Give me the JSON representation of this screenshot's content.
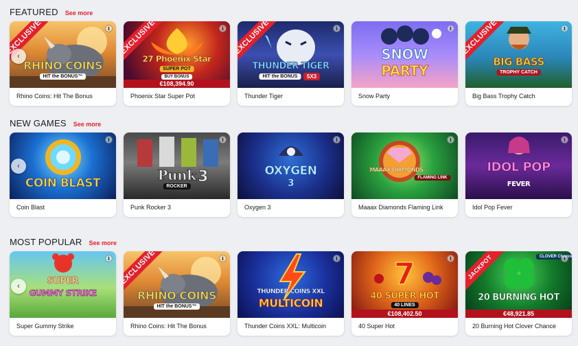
{
  "sections": [
    {
      "title": "FEATURED",
      "see_more": "See more",
      "cards": [
        {
          "label": "Rhino Coins: Hit The Bonus",
          "art_title": "RHINO COINS",
          "art_sub": "HIT the BONUS™",
          "ribbon": "EXCLUSIVE"
        },
        {
          "label": "Phoenix Star Super Pot",
          "art_title": "27 Phoenix Star",
          "art_sub": "SUPER POT",
          "art_pill": "BUY BONUS",
          "ribbon": "EXCLUSIVE",
          "jackpot": "€108,394.90"
        },
        {
          "label": "Thunder Tiger",
          "art_title": "THUNDER TIGER",
          "art_sub": "HIT the BONUS",
          "art_extra": "5X3",
          "ribbon": "EXCLUSIVE"
        },
        {
          "label": "Snow Party",
          "art_title": "SNOW",
          "art_sub": "PARTY"
        },
        {
          "label": "Big Bass Trophy Catch",
          "art_title": "BIG BASS",
          "art_sub": "TROPHY CATCH",
          "ribbon": "EXCLUSIVE"
        }
      ]
    },
    {
      "title": "NEW GAMES",
      "see_more": "See more",
      "cards": [
        {
          "label": "Coin Blast",
          "art_title": "COIN BLAST"
        },
        {
          "label": "Punk Rocker 3",
          "art_title": "Punk",
          "art_sub": "ROCKER",
          "art_extra": "3"
        },
        {
          "label": "Oxygen 3",
          "art_title": "OXYGEN",
          "art_sub": "3"
        },
        {
          "label": "Maaax Diamonds Flaming Link",
          "art_title": "MAAAX DIAMONDS",
          "art_sub": "FLAMING LINK"
        },
        {
          "label": "Idol Pop Fever",
          "art_title": "IDOL POP",
          "art_sub": "FEVER"
        }
      ]
    },
    {
      "title": "MOST POPULAR",
      "see_more": "See more",
      "cards": [
        {
          "label": "Super Gummy Strike",
          "art_title": "SUPER",
          "art_sub": "GUMMY STRIKE"
        },
        {
          "label": "Rhino Coins: Hit The Bonus",
          "art_title": "RHINO COINS",
          "art_sub": "HIT the BONUS™",
          "ribbon": "EXCLUSIVE"
        },
        {
          "label": "Thunder Coins XXL: Multicoin",
          "art_title": "THUNDER COINS XXL",
          "art_sub": "MULTICOIN"
        },
        {
          "label": "40 Super Hot",
          "art_title": "40 SUPER HOT",
          "art_pill": "40 LINES",
          "jackpot": "€108,402.50"
        },
        {
          "label": "20 Burning Hot Clover Chance",
          "art_title": "20 BURNING HOT",
          "art_extra": "CLOVER Chance",
          "ribbon": "JACKPOT",
          "jackpot": "€48,921.85"
        }
      ]
    }
  ],
  "info_glyph": "i",
  "arrow_glyph": "‹",
  "icons": [
    "info-icon",
    "carousel-prev-icon"
  ]
}
